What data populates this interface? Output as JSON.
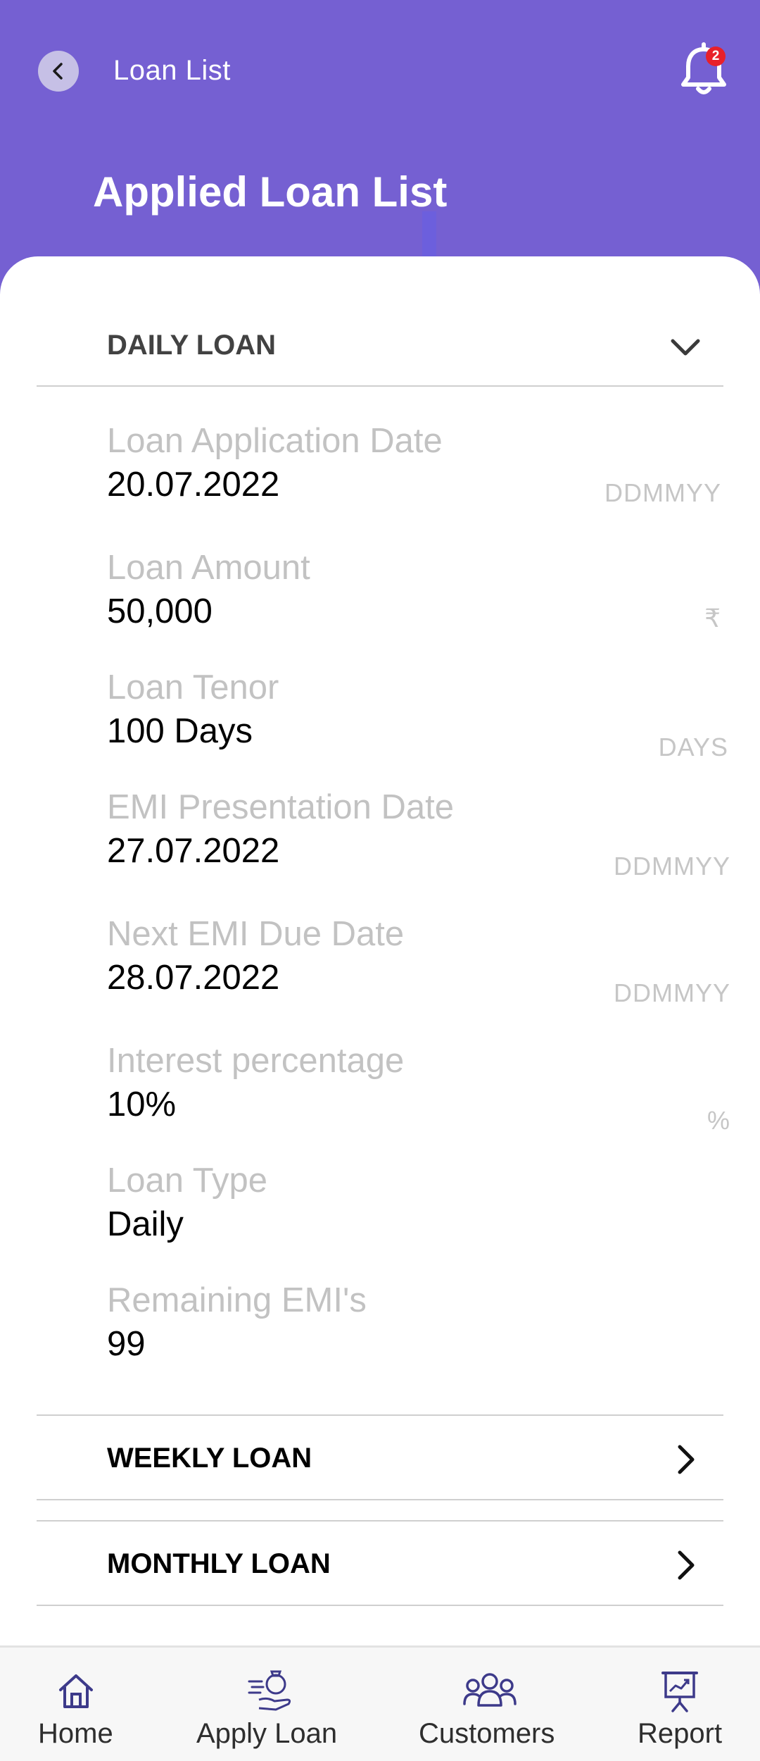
{
  "header": {
    "title": "Loan List",
    "notification_count": "2",
    "page_title": "Applied Loan List"
  },
  "colors": {
    "brand": "#7560d2",
    "badge": "#e8202a",
    "icon": "#3d3a8a"
  },
  "sections": {
    "daily": {
      "label": "DAILY LOAN",
      "expanded": true,
      "fields": [
        {
          "label": "Loan Application Date",
          "value": "20.07.2022",
          "unit": "DDMMYY"
        },
        {
          "label": "Loan Amount",
          "value": "50,000",
          "unit": "₹"
        },
        {
          "label": "Loan Tenor",
          "value": "100 Days",
          "unit": "DAYS"
        },
        {
          "label": "EMI Presentation Date",
          "value": "27.07.2022",
          "unit": "DDMMYY"
        },
        {
          "label": "Next EMI Due Date",
          "value": "28.07.2022",
          "unit": "DDMMYY"
        },
        {
          "label": "Interest percentage",
          "value": "10%",
          "unit": "%"
        },
        {
          "label": "Loan Type",
          "value": "Daily",
          "unit": ""
        },
        {
          "label": "Remaining EMI's",
          "value": "99",
          "unit": ""
        }
      ]
    },
    "weekly": {
      "label": "WEEKLY LOAN"
    },
    "monthly": {
      "label": "MONTHLY LOAN"
    }
  },
  "nav": [
    {
      "label": "Home",
      "icon": "home-icon"
    },
    {
      "label": "Apply Loan",
      "icon": "apply-loan-icon"
    },
    {
      "label": "Customers",
      "icon": "customers-icon"
    },
    {
      "label": "Report",
      "icon": "report-icon"
    }
  ]
}
